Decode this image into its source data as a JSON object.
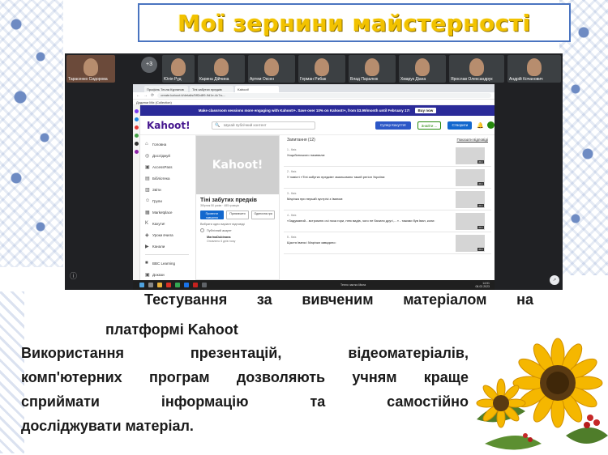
{
  "slide": {
    "title": "Мої зернини майстерності",
    "paragraph_line1": "Тестування   за вивченим матеріалом на",
    "paragraph_line2": "платформі Kahoot",
    "paragraph_line3": "Використання презентацій, відеоматеріалів,",
    "paragraph_line4": "комп'ютерних програм дозволяють учням краще",
    "paragraph_line5": "сприймати інформацію та самостійно",
    "paragraph_line6": "досліджувати матеріал.",
    "colors": {
      "title_yellow": "#f2c200",
      "frame_blue": "#4a74c0",
      "embroidery_blue": "#4a6fb5"
    }
  },
  "video_call": {
    "participant_count": "+3",
    "participants": [
      "Тарасенко Сидорова",
      "Юлія Руд",
      "Карина Дійчина",
      "Артем Оксен",
      "Герман Рибак",
      "Влад Паралюк",
      "Хмарук Діана",
      "Ярослав Олександрук",
      "Андрій Кочанович"
    ]
  },
  "browser": {
    "tabs": [
      "Профіль Тесла Курганов",
      "Тіні забутих предків",
      "Kahoot!"
    ],
    "url": "create.kahoot.it/details/5ff2c8f9-9d1e-4c7a-...",
    "bookmarks": "Додатки  Mix (Collection)"
  },
  "kahoot": {
    "banner_text": "Make classroom sessions more engaging with Kahoot!+. Save over 10% on Kahoot!+, from $3.99/month until February 17!",
    "buy_now": "Buy now",
    "logo": "Kahoot!",
    "search_placeholder": "Шукай публічний контент",
    "super_button": "Супер Кахуття!",
    "join_button": "Знайти ...",
    "create_button": "Створити",
    "nav": [
      "Головна",
      "Досліджуй",
      "AccessPass",
      "Бібліотека",
      "Звіти",
      "Групи",
      "Marketplace",
      "Кахути!",
      "Уроки вчила",
      "Канали"
    ],
    "nav_footer": [
      "BBC Learning",
      "Докази"
    ],
    "quiz": {
      "cover_logo": "Kahoot!",
      "title": "Тіні забутих предків",
      "meta": "Збірник 50 разів · 485 гравців",
      "btn_present": "Провести навчання",
      "btn_assign": "Призначити",
      "btn_solo": "Одиночна гра",
      "note": "Вибрати одно варіант відповіді",
      "visibility": "Публічний акаунт",
      "author": "MarinaDubinana",
      "author_meta": "Оновлено 6 днів тому"
    },
    "questions_header": "Запитання (12)",
    "show_answers": "Показати відповіді",
    "questions": [
      {
        "num": "1 - Квіз",
        "text": "Хоцьбинського називали:",
        "time": "20 с"
      },
      {
        "num": "2 - Квіз",
        "text": "У повісті «Тіні забутих предків» змальовано такий регіон України:",
        "time": "20 с"
      },
      {
        "num": "3 - Квіз",
        "text": "Марічка при першій зустрічі з Іваном:",
        "time": "20 с"
      },
      {
        "num": "4 - Квіз",
        "text": "«Задуманий…встромлю очі поза гори, нею видів, чого не бачили другі,…» - такими був Іван, коли:",
        "time": "20 с"
      },
      {
        "num": "5 - Квіз",
        "text": "Щастя Івана і Марічки завадило:",
        "time": "20 с"
      }
    ]
  },
  "taskbar": {
    "news": "Тепло частко Мила",
    "time": "14:51",
    "date": "06.02.2023"
  }
}
